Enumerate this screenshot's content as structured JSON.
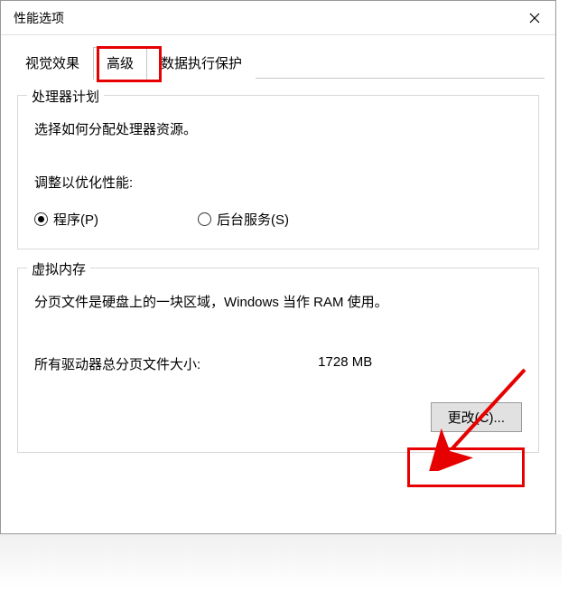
{
  "window": {
    "title": "性能选项"
  },
  "tabs": {
    "visual_effects": "视觉效果",
    "advanced": "高级",
    "dep": "数据执行保护"
  },
  "processor": {
    "group_title": "处理器计划",
    "desc": "选择如何分配处理器资源。",
    "adjust_label": "调整以优化性能:",
    "programs": "程序(P)",
    "background": "后台服务(S)"
  },
  "vm": {
    "group_title": "虚拟内存",
    "desc": "分页文件是硬盘上的一块区域，Windows 当作 RAM 使用。",
    "total_label": "所有驱动器总分页文件大小:",
    "total_value": "1728 MB",
    "change_btn": "更改(C)..."
  }
}
